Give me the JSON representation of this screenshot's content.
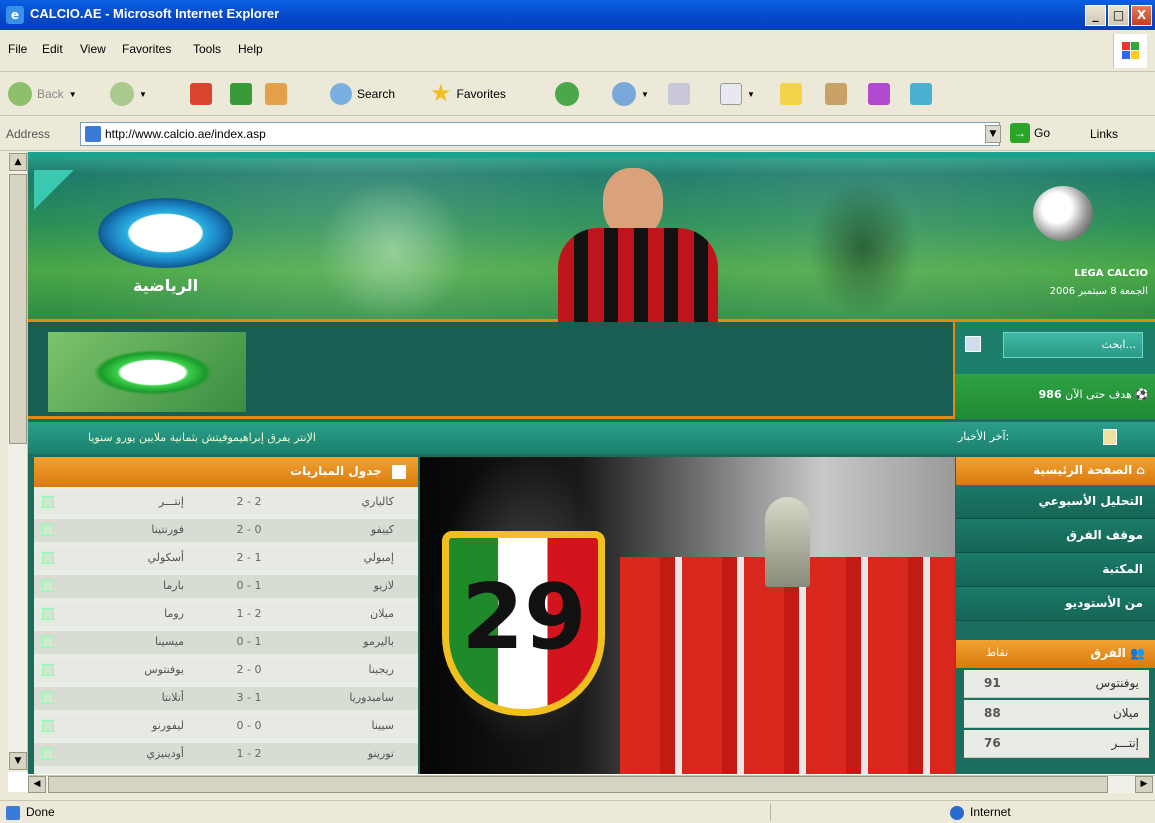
{
  "window": {
    "title": "CALCIO.AE - Microsoft Internet Explorer",
    "min_label": "_",
    "max_label": "□",
    "close_label": "X"
  },
  "menu": {
    "items": [
      "File",
      "Edit",
      "View",
      "Favorites",
      "Tools",
      "Help"
    ]
  },
  "toolbar": {
    "back_label": "Back",
    "search_label": "Search",
    "favorites_label": "Favorites"
  },
  "address": {
    "label": "Address",
    "url": "http://www.calcio.ae/index.asp",
    "go_label": "Go",
    "links_label": "Links"
  },
  "status": {
    "text": "Done",
    "zone": "Internet"
  },
  "page": {
    "banner_logo_text": "الرياضية",
    "lega_text": "LEGA CALCIO",
    "date_text": "الجمعة 8 سبتمبر 2006",
    "search_placeholder": "ابحث...",
    "goals_count": "986",
    "goals_text": "هدف حتى الآن",
    "ticker_label": "آخر الأخبار:",
    "ticker_text": "الإنتر يفرق إبراهيموفيتش بثمانية ملايين يورو سنويا",
    "matches_title": "جدول المباريات",
    "matches": [
      {
        "home": "كالياري",
        "score": "2 - 2",
        "away": "إنتـــر"
      },
      {
        "home": "كييفو",
        "score": "2 - 0",
        "away": "فورنتينا"
      },
      {
        "home": "إمبولي",
        "score": "2 - 1",
        "away": "أسكولي"
      },
      {
        "home": "لازيو",
        "score": "0 - 1",
        "away": "بارما"
      },
      {
        "home": "ميلان",
        "score": "1 - 2",
        "away": "روما"
      },
      {
        "home": "باليرمو",
        "score": "0 - 1",
        "away": "ميسينا"
      },
      {
        "home": "ريجينا",
        "score": "2 - 0",
        "away": "يوفنتوس"
      },
      {
        "home": "سامبدوريا",
        "score": "3 - 1",
        "away": "أتلانتا"
      },
      {
        "home": "سيينا",
        "score": "0 - 0",
        "away": "ليفورنو"
      },
      {
        "home": "تورينو",
        "score": "1 - 2",
        "away": "أودينيزي"
      }
    ],
    "photo_badge_number": "29",
    "nav_home": "الصفحة الرئيسية",
    "nav_items": [
      "التحليل الأسبوعي",
      "موقف الفرق",
      "المكتبة",
      "من الأستوديو"
    ],
    "teams_title": "الفرق",
    "teams_pts_label": "نقاط",
    "teams": [
      {
        "name": "يوفنتوس",
        "pts": "91"
      },
      {
        "name": "ميلان",
        "pts": "88"
      },
      {
        "name": "إنتـــر",
        "pts": "76"
      }
    ]
  },
  "colors": {
    "accent_orange": "#e08a12",
    "teal": "#1b7f6c",
    "xp_blue": "#0548c8"
  }
}
